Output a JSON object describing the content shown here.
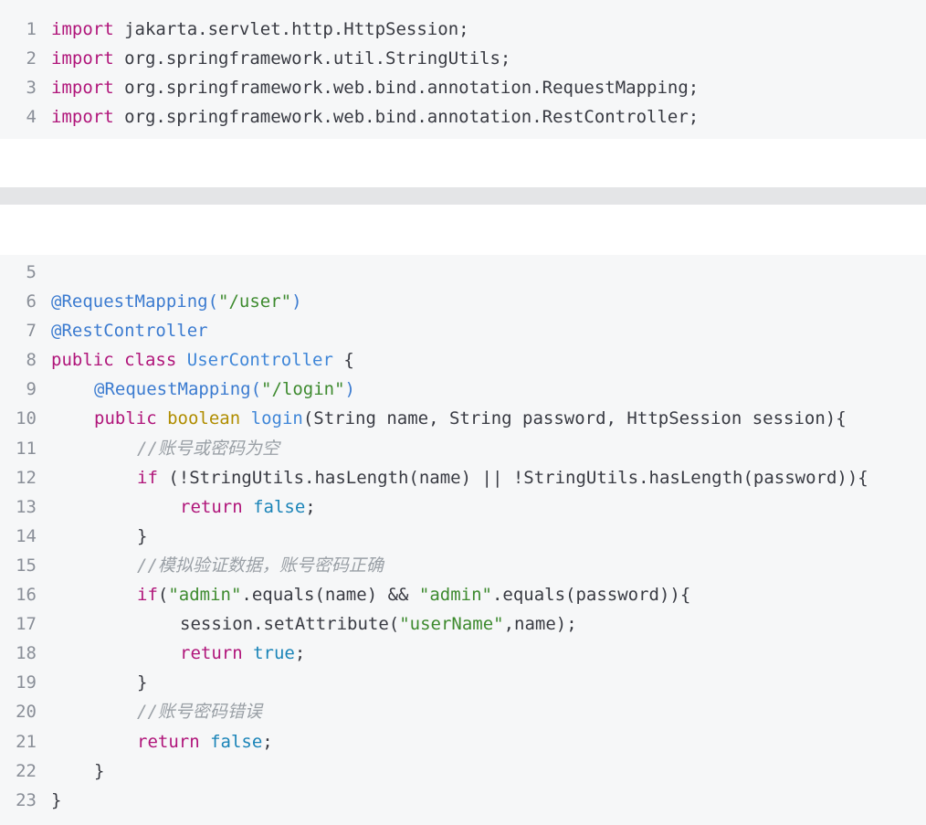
{
  "block1": {
    "lines": [
      {
        "num": "1",
        "kw": "import",
        "text": " jakarta.servlet.http.HttpSession;"
      },
      {
        "num": "2",
        "kw": "import",
        "text": " org.springframework.util.StringUtils;"
      },
      {
        "num": "3",
        "kw": "import",
        "text": " org.springframework.web.bind.annotation.RequestMapping;"
      },
      {
        "num": "4",
        "kw": "import",
        "text": " org.springframework.web.bind.annotation.RestController;"
      }
    ]
  },
  "block2": {
    "l5": {
      "num": "5"
    },
    "l6": {
      "num": "6",
      "ann": "@RequestMapping(",
      "str": "\"/user\"",
      "end": ")"
    },
    "l7": {
      "num": "7",
      "ann": "@RestController"
    },
    "l8": {
      "num": "8",
      "kw1": "public",
      "kw2": "class",
      "name": "UserController",
      "rest": " {"
    },
    "l9": {
      "num": "9",
      "ann": "@RequestMapping(",
      "str": "\"/login\"",
      "end": ")"
    },
    "l10": {
      "num": "10",
      "kw": "public",
      "type": "boolean",
      "fn": "login",
      "rest": "(String name, String password, HttpSession session){"
    },
    "l11": {
      "num": "11",
      "cmt": "//账号或密码为空"
    },
    "l12": {
      "num": "12",
      "kw": "if",
      "rest": " (!StringUtils.hasLength(name) || !StringUtils.hasLength(password)){"
    },
    "l13": {
      "num": "13",
      "kw": "return",
      "lit": "false",
      "end": ";"
    },
    "l14": {
      "num": "14",
      "text": "}"
    },
    "l15": {
      "num": "15",
      "cmt": "//模拟验证数据，账号密码正确"
    },
    "l16": {
      "num": "16",
      "kw": "if",
      "p1": "(",
      "str1": "\"admin\"",
      "p2": ".equals(name) && ",
      "str2": "\"admin\"",
      "p3": ".equals(password)){"
    },
    "l17": {
      "num": "17",
      "p1": "session.setAttribute(",
      "str": "\"userName\"",
      "p2": ",name);"
    },
    "l18": {
      "num": "18",
      "kw": "return",
      "lit": "true",
      "end": ";"
    },
    "l19": {
      "num": "19",
      "text": "}"
    },
    "l20": {
      "num": "20",
      "cmt": "//账号密码错误"
    },
    "l21": {
      "num": "21",
      "kw": "return",
      "lit": "false",
      "end": ";"
    },
    "l22": {
      "num": "22",
      "text": "}"
    },
    "l23": {
      "num": "23",
      "text": "}"
    }
  }
}
